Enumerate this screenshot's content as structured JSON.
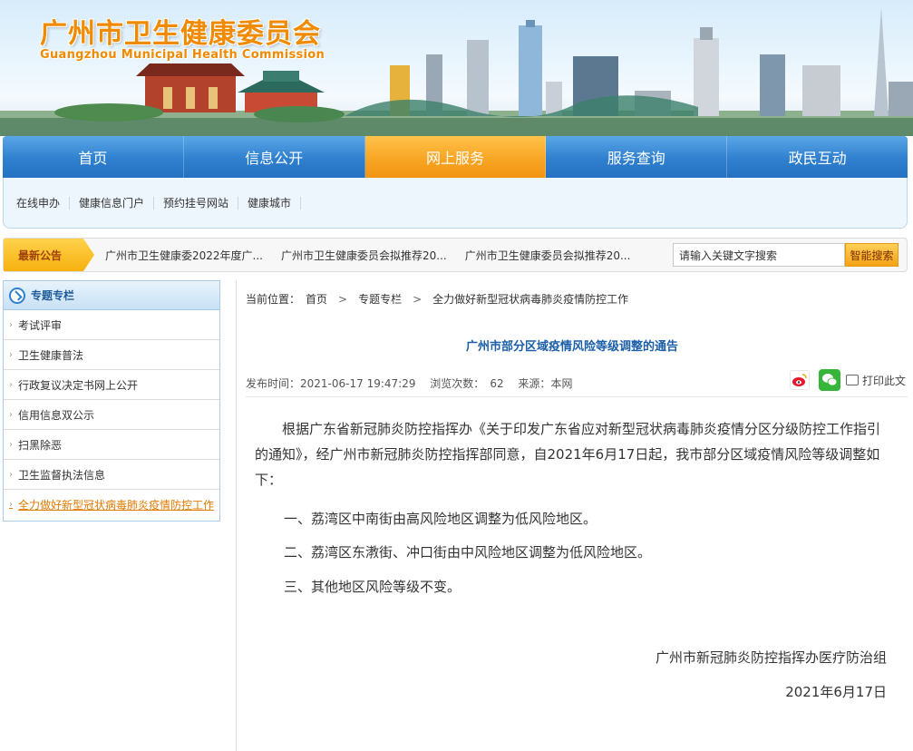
{
  "header": {
    "title_cn": "广州市卫生健康委员会",
    "title_en": "Guangzhou Municipal Health Commission"
  },
  "main_nav": [
    "首页",
    "信息公开",
    "网上服务",
    "服务查询",
    "政民互动"
  ],
  "main_nav_active": "网上服务",
  "sub_nav": [
    "在线申办",
    "健康信息门户",
    "预约挂号网站",
    "健康城市"
  ],
  "notice": {
    "label": "最新公告",
    "items": [
      "广州市卫生健康委2022年度广...",
      "广州市卫生健康委员会拟推荐20...",
      "广州市卫生健康委员会拟推荐20..."
    ]
  },
  "search": {
    "value": "请输入关键文字搜索",
    "button": "智能搜索"
  },
  "sidebar": {
    "title": "专题专栏",
    "items": [
      "考试评审",
      "卫生健康普法",
      "行政复议决定书网上公开",
      "信用信息双公示",
      "扫黑除恶",
      "卫生监督执法信息",
      "全力做好新型冠状病毒肺炎疫情防控工作"
    ],
    "active_index": 6
  },
  "breadcrumb": {
    "prefix": "当前位置：",
    "items": [
      "首页",
      "专题专栏",
      "全力做好新型冠状病毒肺炎疫情防控工作"
    ],
    "separator": ">"
  },
  "article": {
    "title": "广州市部分区域疫情风险等级调整的通告",
    "meta": {
      "published_label": "发布时间：",
      "published": "2021-06-17 19:47:29",
      "views_label": "浏览次数：",
      "views": "62",
      "source_label": "来源：",
      "source": "本网"
    },
    "print_label": "打印此文",
    "intro": "根据广东省新冠肺炎防控指挥办《关于印发广东省应对新型冠状病毒肺炎疫情分区分级防控工作指引的通知》，经广州市新冠肺炎防控指挥部同意，自2021年6月17日起，我市部分区域疫情风险等级调整如下：",
    "items": [
      "一、荔湾区中南街由高风险地区调整为低风险地区。",
      "二、荔湾区东漖街、冲口街由中风险地区调整为低风险地区。",
      "三、其他地区风险等级不变。"
    ],
    "signature": "广州市新冠肺炎防控指挥办医疗防治组",
    "date": "2021年6月17日"
  },
  "colors": {
    "nav_blue": "#2f80cf",
    "nav_active_orange": "#f7a321",
    "title_orange": "#f08a00",
    "article_title_blue": "#1b5fa8"
  }
}
